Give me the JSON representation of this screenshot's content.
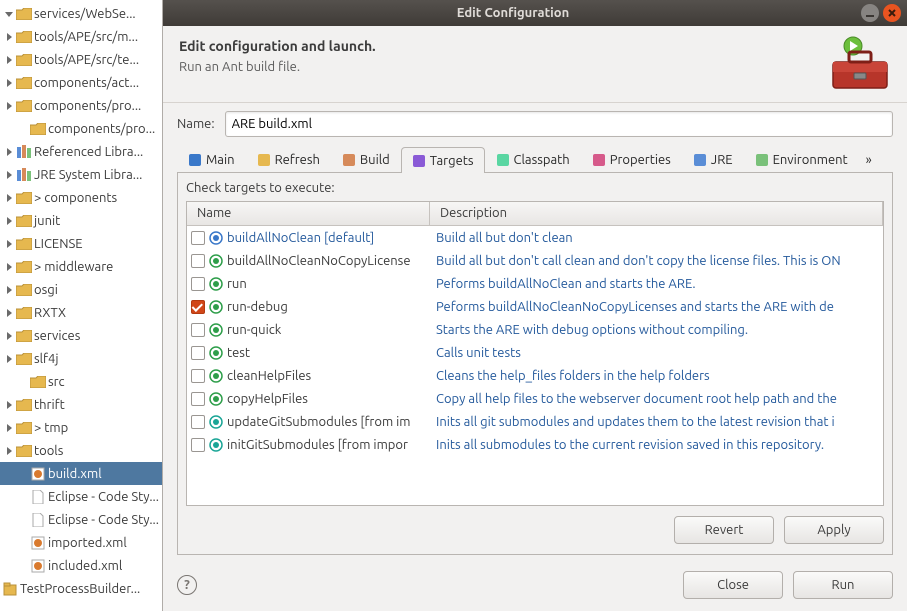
{
  "tree": {
    "items": [
      {
        "label": "services/WebSe...",
        "twisty": "down",
        "icon": "folder",
        "indent": 0
      },
      {
        "label": "tools/APE/src/m...",
        "twisty": "right",
        "icon": "folder-pkg",
        "indent": 0
      },
      {
        "label": "tools/APE/src/te...",
        "twisty": "right",
        "icon": "folder-pkg",
        "indent": 0
      },
      {
        "label": "components/act...",
        "twisty": "right",
        "icon": "folder-pkg",
        "indent": 0
      },
      {
        "label": "components/pro...",
        "twisty": "right",
        "icon": "folder-pkg",
        "indent": 0
      },
      {
        "label": "components/pro...",
        "twisty": "none",
        "icon": "folder-pkg",
        "indent": 1
      },
      {
        "label": "Referenced Libra...",
        "twisty": "right",
        "icon": "lib",
        "indent": 0
      },
      {
        "label": "JRE System Libra...",
        "twisty": "right",
        "icon": "lib",
        "indent": 0
      },
      {
        "label": "> components",
        "twisty": "right",
        "icon": "folder",
        "indent": 0
      },
      {
        "label": "junit",
        "twisty": "right",
        "icon": "folder",
        "indent": 0
      },
      {
        "label": "LICENSE",
        "twisty": "right",
        "icon": "folder",
        "indent": 0
      },
      {
        "label": "> middleware",
        "twisty": "right",
        "icon": "folder",
        "indent": 0
      },
      {
        "label": "osgi",
        "twisty": "right",
        "icon": "folder",
        "indent": 0
      },
      {
        "label": "RXTX",
        "twisty": "right",
        "icon": "folder",
        "indent": 0
      },
      {
        "label": "services",
        "twisty": "right",
        "icon": "folder",
        "indent": 0
      },
      {
        "label": "slf4j",
        "twisty": "right",
        "icon": "folder",
        "indent": 0
      },
      {
        "label": "src",
        "twisty": "none",
        "icon": "folder",
        "indent": 1
      },
      {
        "label": "thrift",
        "twisty": "right",
        "icon": "folder",
        "indent": 0
      },
      {
        "label": "> tmp",
        "twisty": "right",
        "icon": "folder",
        "indent": 0
      },
      {
        "label": "tools",
        "twisty": "right",
        "icon": "folder",
        "indent": 0
      },
      {
        "label": "build.xml",
        "twisty": "none",
        "icon": "ant",
        "indent": 1,
        "selected": true
      },
      {
        "label": "Eclipse - Code Sty...",
        "twisty": "none",
        "icon": "file",
        "indent": 1
      },
      {
        "label": "Eclipse - Code Sty...",
        "twisty": "none",
        "icon": "file",
        "indent": 1
      },
      {
        "label": "imported.xml",
        "twisty": "none",
        "icon": "ant",
        "indent": 1
      },
      {
        "label": "included.xml",
        "twisty": "none",
        "icon": "ant",
        "indent": 1
      },
      {
        "label": "TestProcessBuilder...",
        "twisty": "right",
        "icon": "project",
        "indent": -1
      }
    ]
  },
  "dialog": {
    "title": "Edit Configuration",
    "heading": "Edit configuration and launch.",
    "subheading": "Run an Ant build file.",
    "name_label": "Name:",
    "name_value": "ARE build.xml",
    "tabs": [
      "Main",
      "Refresh",
      "Build",
      "Targets",
      "Classpath",
      "Properties",
      "JRE",
      "Environment"
    ],
    "tabs_active_index": 3,
    "overflow_glyph": "»",
    "targets_caption": "Check targets to execute:",
    "columns": {
      "name": "Name",
      "desc": "Description"
    },
    "targets": [
      {
        "checked": false,
        "icon": "blue",
        "name": "buildAllNoClean [default]",
        "default": true,
        "desc": "Build all but don't clean"
      },
      {
        "checked": false,
        "icon": "green",
        "name": "buildAllNoCleanNoCopyLicense",
        "desc": "Build all but don't call clean and don't copy the license files. This is ON"
      },
      {
        "checked": false,
        "icon": "green",
        "name": "run",
        "desc": "Peforms buildAllNoClean and starts the ARE."
      },
      {
        "checked": true,
        "icon": "green",
        "name": "run-debug",
        "desc": "Peforms buildAllNoCleanNoCopyLicenses and starts the ARE with de"
      },
      {
        "checked": false,
        "icon": "green",
        "name": "run-quick",
        "desc": "Starts the ARE with debug options without compiling."
      },
      {
        "checked": false,
        "icon": "green",
        "name": "test",
        "desc": "Calls unit tests"
      },
      {
        "checked": false,
        "icon": "green",
        "name": "cleanHelpFiles",
        "desc": "Cleans the help_files folders in the help folders"
      },
      {
        "checked": false,
        "icon": "green",
        "name": "copyHelpFiles",
        "desc": "Copy all help files to the webserver document root help path and the"
      },
      {
        "checked": false,
        "icon": "teal",
        "name": "updateGitSubmodules [from im",
        "desc": "Inits all git submodules and updates them to the latest revision that i"
      },
      {
        "checked": false,
        "icon": "teal",
        "name": "initGitSubmodules [from impor",
        "desc": "Inits all submodules to the current revision saved in this repository."
      }
    ],
    "buttons": {
      "revert": "Revert",
      "apply": "Apply",
      "close": "Close",
      "run": "Run"
    },
    "help_glyph": "?"
  }
}
